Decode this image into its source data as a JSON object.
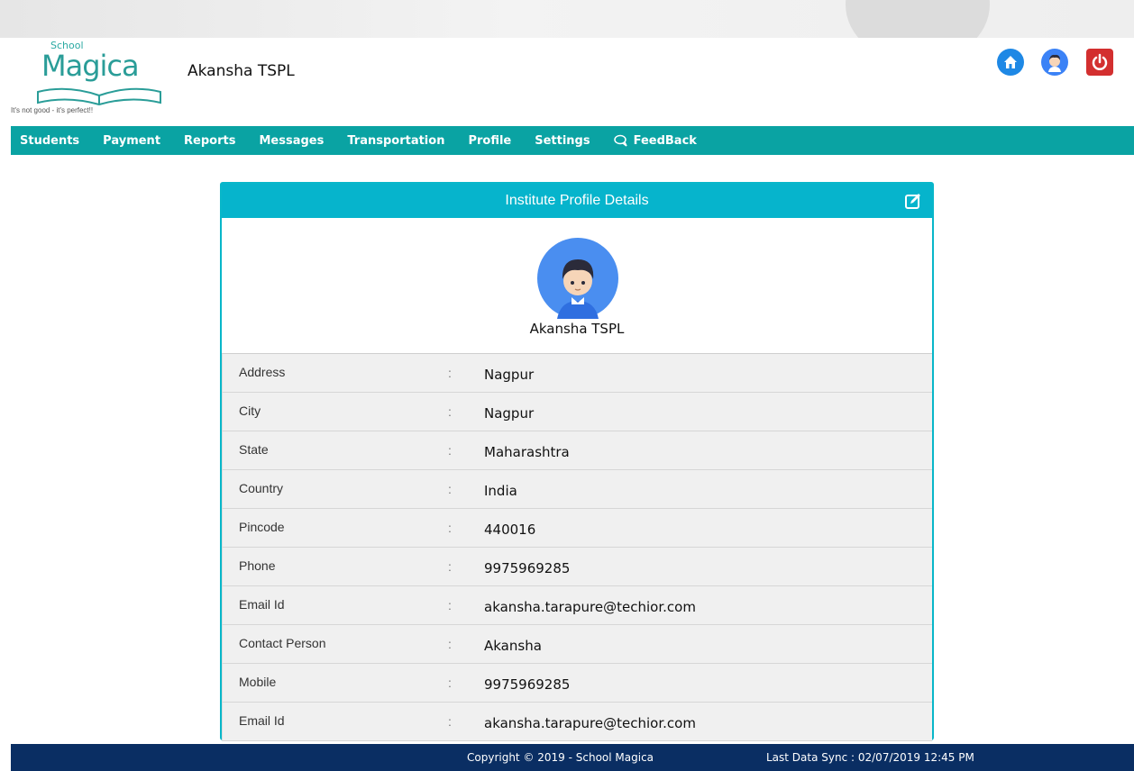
{
  "header": {
    "logo": {
      "top_text": "School",
      "main_text": "Magica",
      "tagline": "It's not good - it's perfect!!"
    },
    "title": "Akansha TSPL",
    "icons": {
      "home": "home-icon",
      "user": "user-avatar-icon",
      "power": "power-icon"
    }
  },
  "nav": {
    "items": [
      {
        "label": "Students"
      },
      {
        "label": "Payment"
      },
      {
        "label": "Reports"
      },
      {
        "label": "Messages"
      },
      {
        "label": "Transportation"
      },
      {
        "label": "Profile"
      },
      {
        "label": "Settings"
      },
      {
        "label": "FeedBack",
        "icon": "chat-icon"
      }
    ]
  },
  "card": {
    "title": "Institute Profile Details",
    "edit_icon": "edit-icon",
    "profile_name": "Akansha TSPL",
    "rows": [
      {
        "label": "Address",
        "value": "Nagpur"
      },
      {
        "label": "City",
        "value": "Nagpur"
      },
      {
        "label": "State",
        "value": "Maharashtra"
      },
      {
        "label": "Country",
        "value": "India"
      },
      {
        "label": "Pincode",
        "value": "440016"
      },
      {
        "label": "Phone",
        "value": "9975969285"
      },
      {
        "label": "Email Id",
        "value": "akansha.tarapure@techior.com"
      },
      {
        "label": "Contact Person",
        "value": "Akansha"
      },
      {
        "label": "Mobile",
        "value": "9975969285"
      },
      {
        "label": "Email Id",
        "value": "akansha.tarapure@techior.com"
      }
    ],
    "separator": ":"
  },
  "footer": {
    "copyright": "Copyright © 2019 - School Magica",
    "sync": "Last Data Sync : 02/07/2019 12:45 PM"
  },
  "colors": {
    "nav_bg": "#0aa3a3",
    "card_head": "#06b4cc",
    "footer_bg": "#0a2e63"
  }
}
